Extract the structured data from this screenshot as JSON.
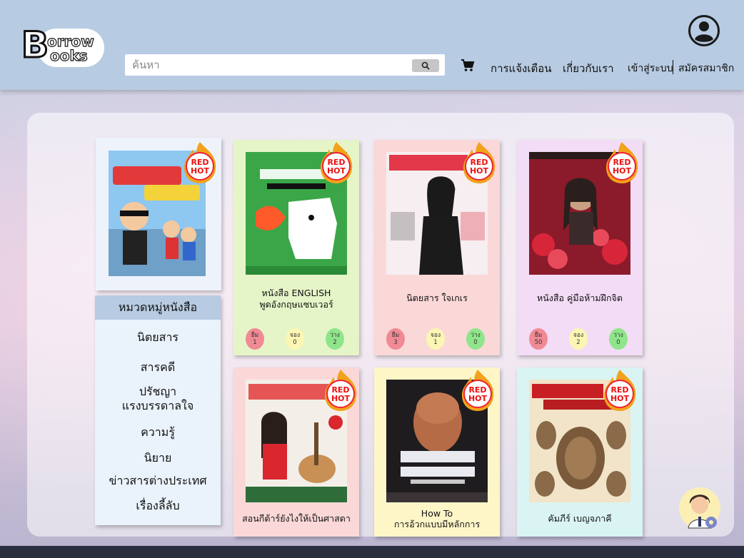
{
  "header": {
    "logo": {
      "letter": "B",
      "line1": "orrow",
      "line2": "ooks"
    },
    "search": {
      "placeholder": "ค้นหา"
    },
    "nav": {
      "notifications": "การแจ้งเตือน",
      "about": "เกี่ยวกับเรา",
      "login": "เข้าสู่ระบบ",
      "register": "สมัครสมาชิก"
    }
  },
  "featured": {
    "badge": "RED HOT"
  },
  "categories": {
    "heading": "หมวดหมู่หนังสือ",
    "items": [
      "นิตยสาร",
      "สารคดี",
      "ปรัชญา",
      "แรงบรรดาลใจ",
      "ความรู้",
      "นิยาย",
      "ข่าวสารต่างประเทศ",
      "เรื่องลี้ลับ"
    ]
  },
  "stat_labels": {
    "borrow": "ยืม",
    "reserve": "จอง",
    "free": "ว่าง"
  },
  "books": [
    {
      "title_1": "หนังสือ ENGLISH",
      "title_2": "พูดอังกฤษแซบเวอร์",
      "borrow": "1",
      "reserve": "0",
      "free": "2",
      "bg": "#e6f5c8"
    },
    {
      "title_1": "นิตยสาร ใจเกเร",
      "title_2": "",
      "borrow": "3",
      "reserve": "1",
      "free": "0",
      "bg": "#fbd8d8"
    },
    {
      "title_1": "หนังสือ คู่มือห้ามฝึกจิต",
      "title_2": "",
      "borrow": "50",
      "reserve": "2",
      "free": "0",
      "bg": "#f3dcf6"
    },
    {
      "title_1": "สอนกีต้าร์ยังไงให้เป็นศาสดา",
      "title_2": "",
      "bg": "#fbd8d8"
    },
    {
      "title_1": "How To",
      "title_2": "การอ้วกแบบมีหลักการ",
      "bg": "#fff6c8"
    },
    {
      "title_1": "คัมภีร์ เบญจภาคี",
      "title_2": "",
      "bg": "#d9f4f2"
    }
  ],
  "colors": {
    "header": "#b7cbe2",
    "borrow": "#f08a95",
    "reserve": "#fbf6b3",
    "free": "#8fe58a"
  },
  "icons": [
    "search-icon",
    "cart-icon",
    "user-account-icon",
    "red-hot-flame-icon",
    "assistant-avatar-icon",
    "gear-icon"
  ]
}
